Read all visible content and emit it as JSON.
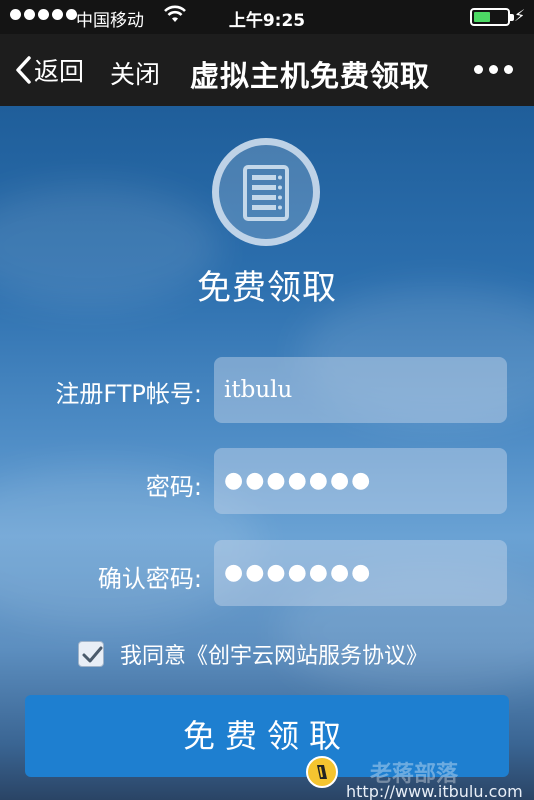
{
  "status_bar": {
    "carrier": "中国移动",
    "time": "上午9:25",
    "battery_level": 0.45
  },
  "nav": {
    "back_label": "返回",
    "close_label": "关闭",
    "title": "虚拟主机免费领取"
  },
  "form": {
    "heading": "免费领取",
    "ftp_label": "注册FTP帐号:",
    "ftp_value": "itbulu",
    "password_label": "密码:",
    "password_value": "●●●●●●●",
    "confirm_label": "确认密码:",
    "confirm_value": "●●●●●●●",
    "agree_checked": true,
    "agree_text": "我同意《创宇云网站服务协议》",
    "submit_label": "免费领取"
  },
  "watermark": {
    "brand_text": "老蒋部落",
    "url": "http://www.itbulu.com"
  },
  "colors": {
    "submit_bg": "#1e7fd0",
    "battery_fill": "#4cd964"
  }
}
